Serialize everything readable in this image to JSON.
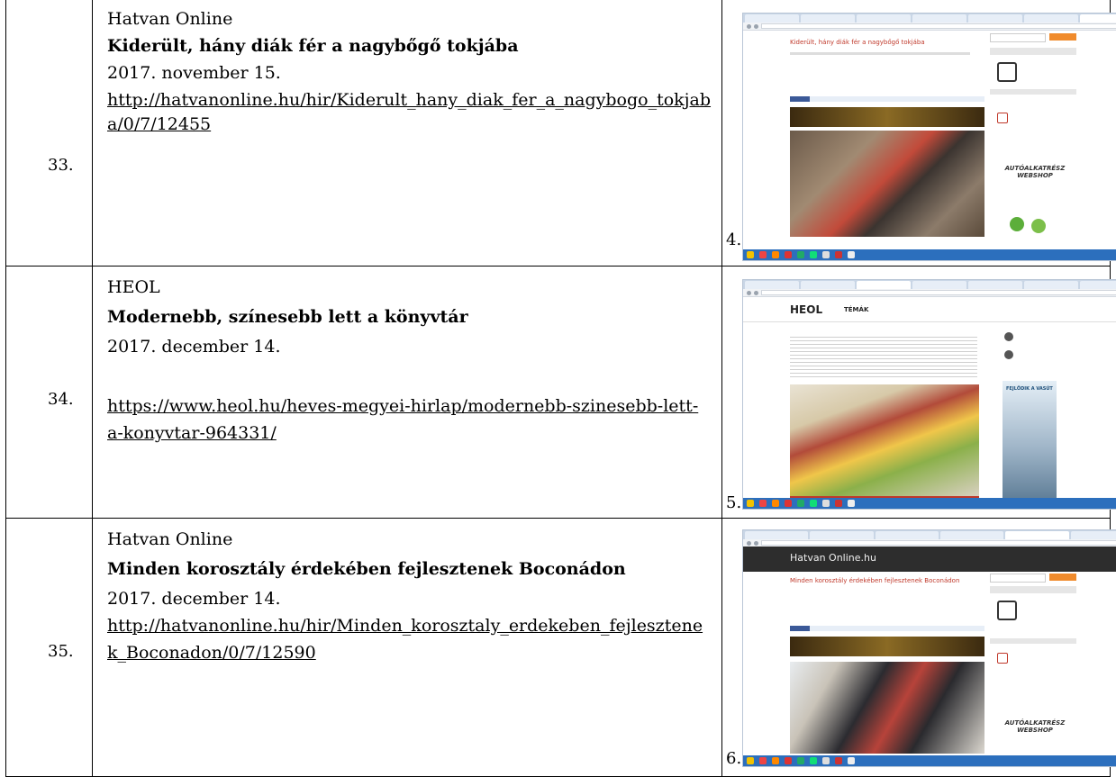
{
  "rows": [
    {
      "num": "33.",
      "source": "Hatvan Online",
      "title": "Kiderült, hány diák fér a nagybőgő tokjába",
      "date": "2017. november 15.",
      "url": "http://hatvanonline.hu/hir/Kiderult_hany_diak_fer_a_nagybogo_tokjaba/0/7/12455",
      "figure": "4.",
      "thumb_headline": "Kiderült, hány diák fér a nagybőgő tokjába",
      "thumb_banner": "AUTÓALKATRÉSZ WEBSHOP"
    },
    {
      "num": "34.",
      "source": "HEOL",
      "title": "Modernebb, színesebb lett a könyvtár",
      "date": "2017. december 14.",
      "url": "https://www.heol.hu/heves-megyei-hirlap/modernebb-szinesebb-lett-a-konyvtar-964331/",
      "figure": "5.",
      "thumb_logo": "HEOL",
      "thumb_nav": "TÉMÁK",
      "thumb_banner": "FEJLŐDIK A VASÚT"
    },
    {
      "num": "35.",
      "source": "Hatvan Online",
      "title": "Minden korosztály érdekében fejlesztenek Boconádon",
      "date": "2017. december 14.",
      "url": "http://hatvanonline.hu/hir/Minden_korosztaly_erdekeben_fejlesztenek_Boconadon/0/7/12590",
      "figure": "6.",
      "thumb_logo": "Hatvan Online.hu",
      "thumb_headline": "Minden korosztály érdekében fejlesztenek Boconádon",
      "thumb_banner": "AUTÓALKATRÉSZ WEBSHOP"
    }
  ],
  "colors": {
    "accent_red": "#c0392b",
    "taskbar_blue": "#2c6fbd",
    "orange": "#f08b2c"
  }
}
